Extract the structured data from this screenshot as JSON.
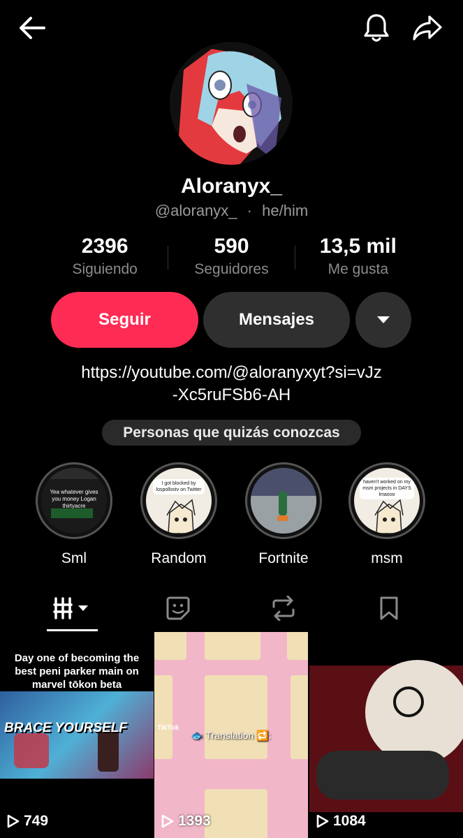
{
  "profile": {
    "display_name": "Aloranyx_",
    "handle": "@aloranyx_",
    "separator": "·",
    "pronouns": "he/him"
  },
  "stats": [
    {
      "value": "2396",
      "label": "Siguiendo"
    },
    {
      "value": "590",
      "label": "Seguidores"
    },
    {
      "value": "13,5 mil",
      "label": "Me gusta"
    }
  ],
  "actions": {
    "follow_label": "Seguir",
    "message_label": "Mensajes"
  },
  "bio": {
    "link_line1": "https://youtube.com/@aloranyxyt?si=vJz",
    "link_line2": "-Xc5ruFSb6-AH"
  },
  "suggestions_label": "Personas que quizás conozcas",
  "highlights": [
    {
      "label": "Sml",
      "cover_text": "Yea whatever gives you money Logan thirtyacre"
    },
    {
      "label": "Random",
      "cover_text": "I got blocked by lospollostv on Twitter"
    },
    {
      "label": "Fortnite",
      "cover_text": ""
    },
    {
      "label": "msm",
      "cover_text": "haven't worked on my msm projects in DAYS lmaooo"
    }
  ],
  "tabs": [
    {
      "icon": "grid-videos-icon",
      "active": true
    },
    {
      "icon": "sticker-icon",
      "active": false
    },
    {
      "icon": "repost-icon",
      "active": false
    },
    {
      "icon": "bookmark-icon",
      "active": false
    }
  ],
  "videos": [
    {
      "caption": "Day one of becoming the best peni parker main on marvel tōkon beta",
      "overlay": "BRACE YOURSELF",
      "views": "749"
    },
    {
      "caption": "🐟 Translation 🔁:",
      "overlay": "TikTok",
      "views": "1393"
    },
    {
      "caption": "",
      "overlay": "",
      "views": "1084"
    }
  ],
  "colors": {
    "background": "#000000",
    "accent": "#fe2c55",
    "button_secondary": "#2f2f2f",
    "muted_text": "#8b8b8b"
  }
}
